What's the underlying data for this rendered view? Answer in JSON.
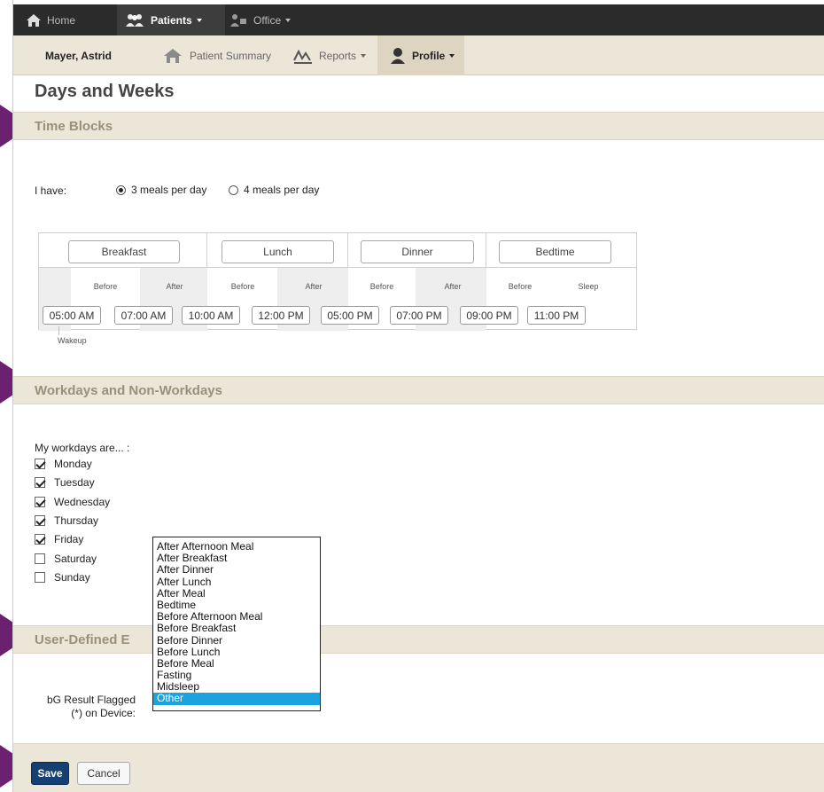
{
  "nav": {
    "home": "Home",
    "patients": "Patients",
    "office": "Office"
  },
  "subnav": {
    "patient_name": "Mayer, Astrid",
    "summary": "Patient Summary",
    "reports": "Reports",
    "profile": "Profile"
  },
  "page_title": "Days and Weeks",
  "time_blocks": {
    "title": "Time Blocks",
    "i_have_label": "I have:",
    "option_3": "3 meals per day",
    "option_4": "4 meals per day",
    "selected": "3 meals per day",
    "headers": [
      "Breakfast",
      "Lunch",
      "Dinner",
      "Bedtime"
    ],
    "sublabels": [
      "Before",
      "After",
      "Before",
      "After",
      "Before",
      "After",
      "Before",
      "Sleep"
    ],
    "times": [
      "05:00 AM",
      "07:00 AM",
      "10:00 AM",
      "12:00 PM",
      "05:00 PM",
      "07:00 PM",
      "09:00 PM",
      "11:00 PM"
    ],
    "wakeup_label": "Wakeup"
  },
  "workdays": {
    "title": "Workdays and Non-Workdays",
    "prompt": "My workdays are... :",
    "days": [
      {
        "label": "Monday",
        "checked": true
      },
      {
        "label": "Tuesday",
        "checked": true
      },
      {
        "label": "Wednesday",
        "checked": true
      },
      {
        "label": "Thursday",
        "checked": true
      },
      {
        "label": "Friday",
        "checked": true
      },
      {
        "label": "Saturday",
        "checked": false
      },
      {
        "label": "Sunday",
        "checked": false
      }
    ]
  },
  "user_defined": {
    "title": "User-Defined E",
    "bg_label_line1": "bG Result Flagged",
    "bg_label_line2": "(*) on Device:",
    "options": [
      "After Afternoon Meal",
      "After Breakfast",
      "After Dinner",
      "After Lunch",
      "After Meal",
      "Bedtime",
      "Before Afternoon Meal",
      "Before Breakfast",
      "Before Dinner",
      "Before Lunch",
      "Before Meal",
      "Fasting",
      "Midsleep",
      "Other"
    ],
    "selected_option": "Other"
  },
  "buttons": {
    "save": "Save",
    "cancel": "Cancel"
  },
  "colors": {
    "nav_bg": "#2b2b2b",
    "section_bg": "#ece6d9",
    "section_text": "#9a8f7b",
    "save_bg": "#163f73",
    "highlight": "#1aa3df",
    "arrow": "#6b2070"
  }
}
